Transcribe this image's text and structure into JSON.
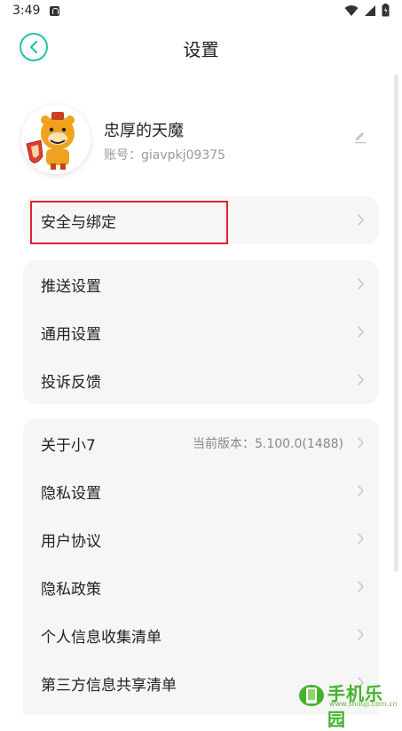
{
  "status_bar": {
    "time": "3:49"
  },
  "header": {
    "title": "设置"
  },
  "profile": {
    "username": "忠厚的天魔",
    "account_label": "账号：",
    "account_id": "giavpkj09375"
  },
  "sections": {
    "security": [
      {
        "label": "安全与绑定"
      }
    ],
    "general": [
      {
        "label": "推送设置"
      },
      {
        "label": "通用设置"
      },
      {
        "label": "投诉反馈"
      }
    ],
    "about": [
      {
        "label": "关于小7",
        "value": "当前版本：5.100.0(1488)"
      },
      {
        "label": "隐私设置"
      },
      {
        "label": "用户协议"
      },
      {
        "label": "隐私政策"
      },
      {
        "label": "个人信息收集清单"
      },
      {
        "label": "第三方信息共享清单"
      }
    ]
  },
  "watermark": {
    "text": "手机乐园",
    "url": "www.shouji.com.cn"
  },
  "colors": {
    "accent": "#23c3a4",
    "highlight": "#e0222c",
    "card_bg": "#f6f6f6"
  }
}
